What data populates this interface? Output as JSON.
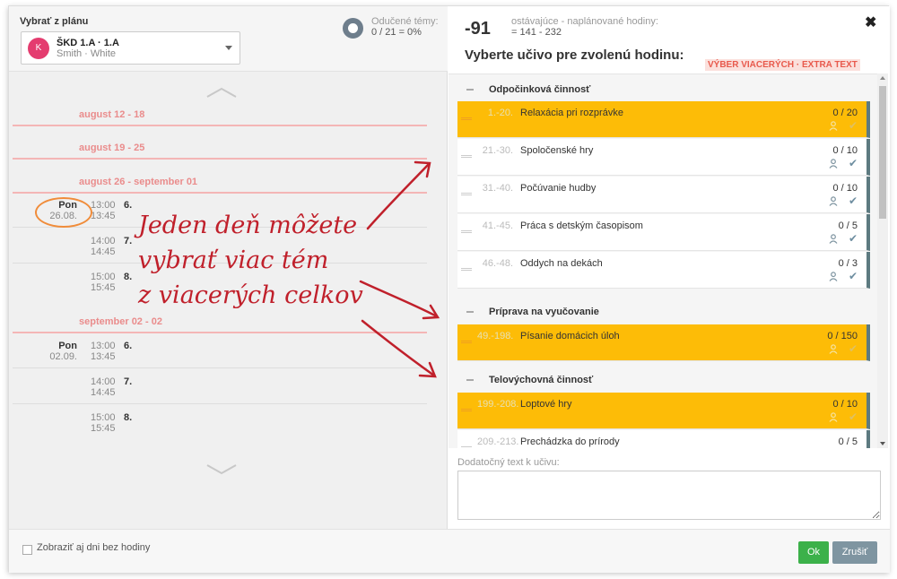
{
  "left": {
    "plan_label": "Vybrať z plánu",
    "class_name": "ŠKD 1.A · 1.A",
    "class_teachers": "Smith · White",
    "avatar": "K",
    "progress_label": "Odučené témy:",
    "progress_value": "0 / 21 = 0%"
  },
  "weeks": [
    "august 12 - 18",
    "august 19 - 25",
    "august 26 - september 01",
    "september 02 - 02"
  ],
  "days": [
    {
      "name": "Pon",
      "date": "26.08.",
      "slots": [
        {
          "time1": "13:00",
          "time2": "13:45",
          "num": "6."
        },
        {
          "time1": "14:00",
          "time2": "14:45",
          "num": "7."
        },
        {
          "time1": "15:00",
          "time2": "15:45",
          "num": "8."
        }
      ]
    },
    {
      "name": "Pon",
      "date": "02.09.",
      "slots": [
        {
          "time1": "13:00",
          "time2": "13:45",
          "num": "6."
        },
        {
          "time1": "14:00",
          "time2": "14:45",
          "num": "7."
        },
        {
          "time1": "15:00",
          "time2": "15:45",
          "num": "8."
        }
      ]
    }
  ],
  "annotation": [
    "Jeden deň môžete",
    "vybrať viac tém",
    "z viacerých celkov"
  ],
  "right": {
    "remaining": "-91",
    "remaining_label": "ostávajúce - naplánované hodiny:",
    "remaining_calc": "= 141 - 232",
    "close": "✖",
    "title": "Vyberte učivo pre zvolenú hodinu:",
    "multi_label": "VÝBER VIACERÝCH · EXTRA TEXT",
    "extra_text_label": "Dodatočný text k učivu:"
  },
  "groups": [
    {
      "title": "Odpočinková činnosť",
      "items": [
        {
          "range": "1.-20.",
          "name": "Relaxácia pri rozprávke",
          "count": "0 / 20",
          "selected": true
        },
        {
          "range": "21.-30.",
          "name": "Spoločenské hry",
          "count": "0 / 10",
          "selected": false
        },
        {
          "range": "31.-40.",
          "name": "Počúvanie hudby",
          "count": "0 / 10",
          "selected": false
        },
        {
          "range": "41.-45.",
          "name": "Práca s detským časopisom",
          "count": "0 / 5",
          "selected": false
        },
        {
          "range": "46.-48.",
          "name": "Oddych na dekách",
          "count": "0 / 3",
          "selected": false
        }
      ]
    },
    {
      "title": "Príprava na vyučovanie",
      "items": [
        {
          "range": "49.-198.",
          "name": "Písanie domácich úloh",
          "count": "0 / 150",
          "selected": true
        }
      ]
    },
    {
      "title": "Telovýchovná činnosť",
      "items": [
        {
          "range": "199.-208.",
          "name": "Loptové hry",
          "count": "0 / 10",
          "selected": true
        },
        {
          "range": "209.-213.",
          "name": "Prechádzka do prírody",
          "count": "0 / 5",
          "selected": false
        }
      ]
    }
  ],
  "footer": {
    "show_days_label": "Zobraziť aj dni bez hodiny",
    "ok": "Ok",
    "cancel": "Zrušiť"
  },
  "colors": {
    "selected": "#fdbc07",
    "ok": "#3cb14a",
    "cancel": "#7f95a1",
    "week": "#ea8c8c",
    "annotation": "#c0202b",
    "avatar": "#e43c6f"
  }
}
